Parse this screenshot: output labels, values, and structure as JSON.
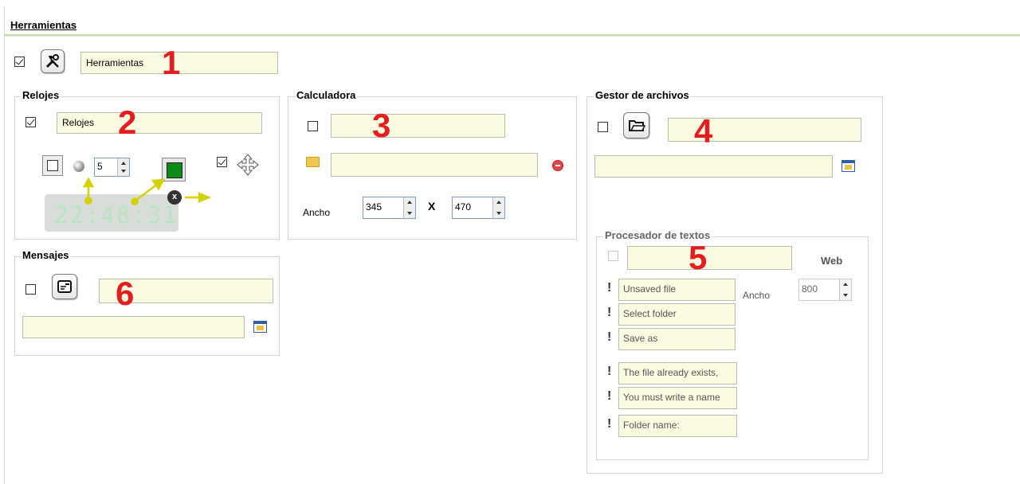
{
  "page": {
    "title": "Herramientas"
  },
  "tools": {
    "checked": true,
    "name": "Herramientas",
    "number": "1"
  },
  "clocks": {
    "group_label": "Relojes",
    "checked": true,
    "name": "Relojes",
    "number": "2",
    "size_value": "5",
    "square_checked": false,
    "move_checked": true,
    "color": "#0d8a17",
    "display_time": "22:48:31"
  },
  "calculator": {
    "group_label": "Calculadora",
    "checked": false,
    "name": "",
    "path": "",
    "number": "3",
    "width_label": "Ancho",
    "width": "345",
    "times": "X",
    "height": "470"
  },
  "files": {
    "group_label": "Gestor de archivos",
    "checked": false,
    "name": "",
    "path": "",
    "number": "4"
  },
  "word": {
    "group_label": "Procesador de textos",
    "checked": false,
    "name": "",
    "number": "5",
    "web_label": "Web",
    "width_label": "Ancho",
    "width": "800",
    "messages": [
      "Unsaved file",
      "Select folder",
      "Save as",
      "The file already exists,",
      "You must write a name",
      "Folder name:"
    ]
  },
  "messages": {
    "group_label": "Mensajes",
    "checked": false,
    "name": "",
    "path": "",
    "number": "6"
  },
  "colors": {
    "field_bg": "#fbfbe2",
    "number_red": "#e31e1e",
    "accent_line": "#c8d7a6",
    "arrow_yellow": "#d4d400"
  }
}
